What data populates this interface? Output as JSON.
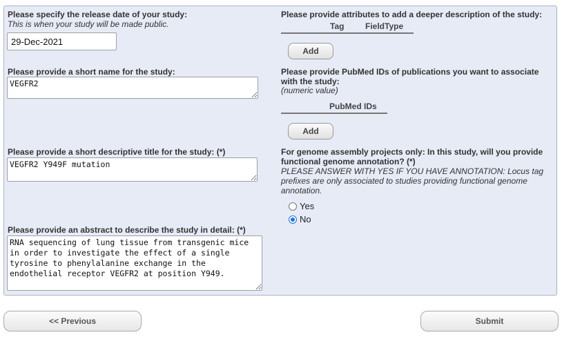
{
  "release": {
    "label": "Please specify the release date of your study:",
    "note": "This is when your study will be made public.",
    "value": "29-Dec-2021"
  },
  "short_name": {
    "label": "Please provide a short name for the study:",
    "value": "VEGFR2"
  },
  "title": {
    "label": "Please provide a short descriptive title for the study: (*)",
    "value": "VEGFR2 Y949F mutation"
  },
  "abstract": {
    "label": "Please provide an abstract to describe the study in detail: (*)",
    "value": "RNA sequencing of lung tissue from transgenic mice in order to investigate the effect of a single tyrosine to phenylalanine exchange in the endothelial receptor VEGFR2 at position Y949."
  },
  "attributes": {
    "label": "Please provide attributes to add a deeper description of the study:",
    "col_tag": "Tag",
    "col_fieldtype": "FieldType",
    "add_label": "Add"
  },
  "pubmed": {
    "label_line1": "Please provide PubMed IDs of publications you want to associate",
    "label_line2": "with the study:",
    "note": "(numeric value)",
    "col_ids": "PubMed IDs",
    "add_label": "Add"
  },
  "annotation": {
    "label_line1": "For genome assembly projects only: In this study, will you provide",
    "label_line2": "functional genome annotation? (*)",
    "note_line1": "PLEASE ANSWER WITH YES IF YOU HAVE ANNOTATION: Locus tag",
    "note_line2": "prefixes are only associated to studies providing functional genome",
    "note_line3": "annotation.",
    "yes_label": "Yes",
    "no_label": "No",
    "selected": "No"
  },
  "nav": {
    "previous_label": "<< Previous",
    "submit_label": "Submit"
  }
}
